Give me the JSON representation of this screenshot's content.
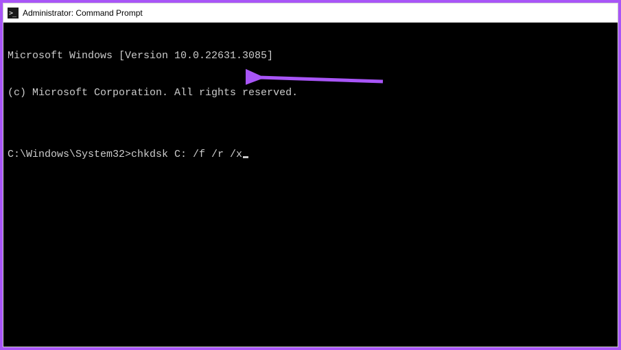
{
  "titlebar": {
    "icon_glyph": "▪\\",
    "title": "Administrator: Command Prompt"
  },
  "console": {
    "line1": "Microsoft Windows [Version 10.0.22631.3085]",
    "line2": "(c) Microsoft Corporation. All rights reserved.",
    "blank": "",
    "prompt": "C:\\Windows\\System32>",
    "command": "chkdsk C: /f /r /x"
  },
  "annotation": {
    "arrow_color": "#a855f7"
  }
}
